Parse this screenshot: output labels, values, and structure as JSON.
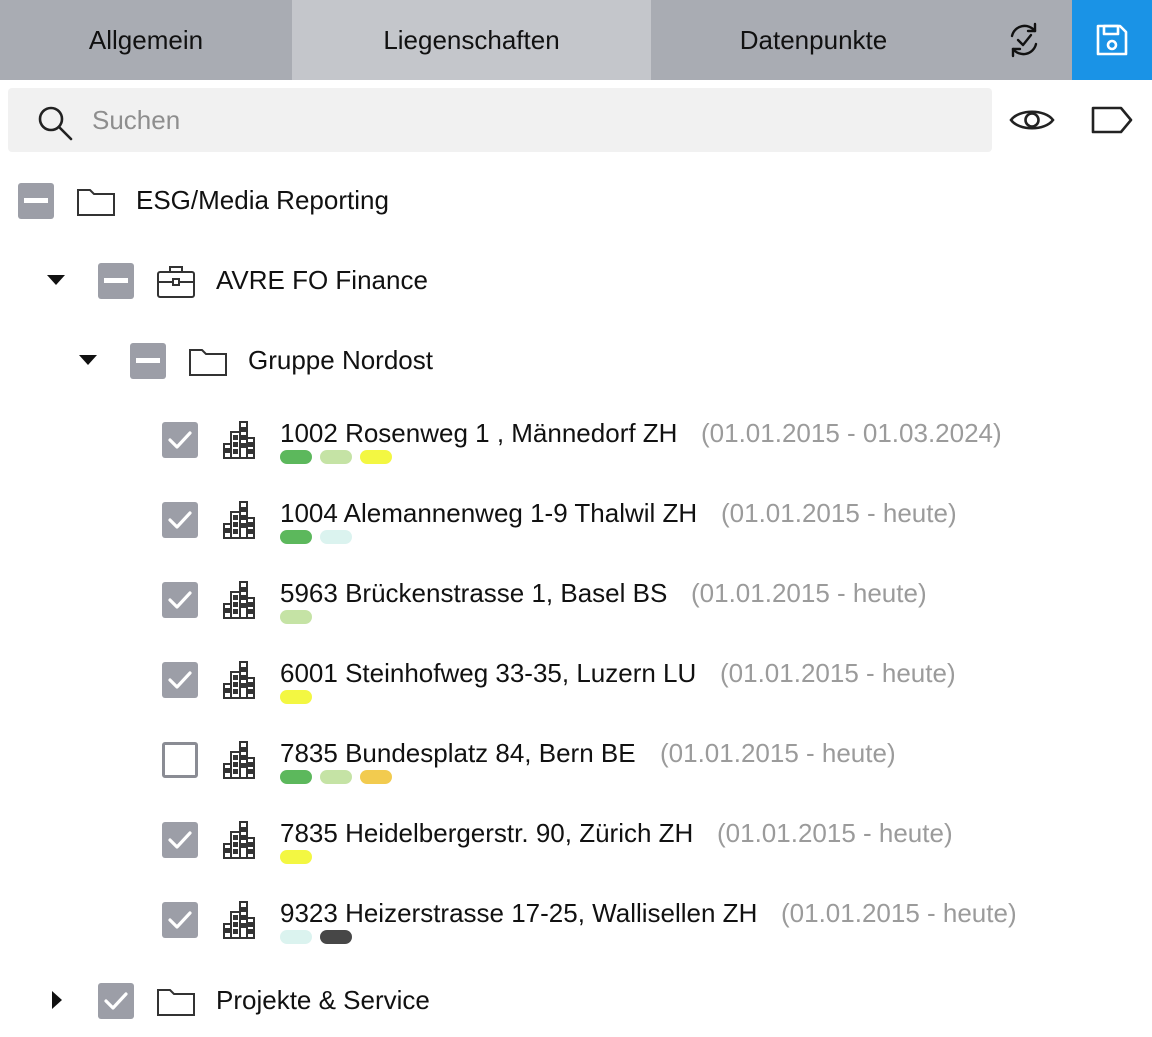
{
  "tabs": {
    "general": "Allgemein",
    "properties": "Liegenschaften",
    "datapoints": "Datenpunkte",
    "sync_icon": "sync-check-icon",
    "save_icon": "floppy-disk-icon"
  },
  "colors": {
    "tabbar": "#a9acb3",
    "active_tab": "#c4c6cb",
    "save": "#1a93e6",
    "checkbox": "#9c9ea7",
    "pill_dark_green": "#5cb85c",
    "pill_light_green": "#c5e3a5",
    "pill_yellow": "#f3f742",
    "pill_light_cyan": "#dbf3ef",
    "pill_orange": "#f2cb4f",
    "pill_dark": "#474747"
  },
  "search": {
    "placeholder": "Suchen",
    "value": ""
  },
  "toolbar": {
    "eye_icon": "eye-icon",
    "tag_icon": "tag-icon"
  },
  "tree": {
    "root": {
      "label": "ESG/Media Reporting",
      "state": "indeterminate"
    },
    "company": {
      "label": "AVRE FO Finance",
      "state": "indeterminate",
      "expanded": true
    },
    "group": {
      "label": "Gruppe Nordost",
      "state": "indeterminate",
      "expanded": true
    },
    "properties": [
      {
        "label": "1002 Rosenweg 1 , Männedorf ZH",
        "period": "(01.01.2015 - 01.03.2024)",
        "checked": true,
        "pills": [
          "#5cb85c",
          "#c5e3a5",
          "#f3f742"
        ]
      },
      {
        "label": "1004 Alemannenweg 1-9 Thalwil ZH",
        "period": "(01.01.2015 - heute)",
        "checked": true,
        "pills": [
          "#5cb85c",
          "#dbf3ef"
        ]
      },
      {
        "label": "5963 Brückenstrasse 1, Basel BS",
        "period": "(01.01.2015 - heute)",
        "checked": true,
        "pills": [
          "#c5e3a5"
        ]
      },
      {
        "label": "6001 Steinhofweg 33-35, Luzern LU",
        "period": "(01.01.2015 - heute)",
        "checked": true,
        "pills": [
          "#f3f742"
        ]
      },
      {
        "label": "7835 Bundesplatz 84, Bern BE",
        "period": "(01.01.2015 - heute)",
        "checked": false,
        "pills": [
          "#5cb85c",
          "#c5e3a5",
          "#f2cb4f"
        ]
      },
      {
        "label": "7835 Heidelbergerstr. 90, Zürich ZH",
        "period": "(01.01.2015 - heute)",
        "checked": true,
        "pills": [
          "#f3f742"
        ]
      },
      {
        "label": "9323 Heizerstrasse 17-25, Wallisellen ZH",
        "period": "(01.01.2015 - heute)",
        "checked": true,
        "pills": [
          "#dbf3ef",
          "#474747"
        ]
      }
    ],
    "other_group": {
      "label": "Projekte & Service",
      "state": "checked",
      "expanded": false
    }
  }
}
